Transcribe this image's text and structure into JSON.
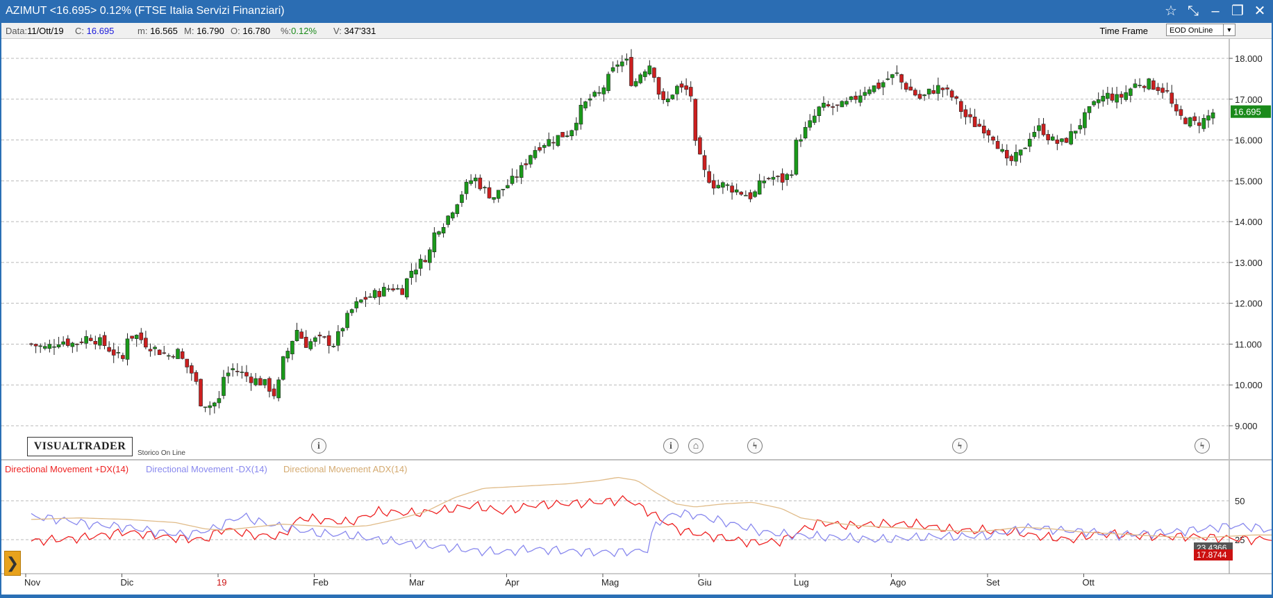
{
  "window": {
    "title": "AZIMUT <16.695> 0.12%  (FTSE Italia Servizi Finanziari)",
    "icons": [
      "star-icon",
      "pin-icon",
      "minimize-icon",
      "maximize-icon",
      "close-icon"
    ]
  },
  "info": {
    "data_label": "Data:",
    "data_value": "11/Ott/19",
    "c_label": "C:",
    "c_value": "16.695",
    "m_label": "m:",
    "m_value": "16.565",
    "M_label": "M:",
    "M_value": "16.790",
    "o_label": "O:",
    "o_value": "16.780",
    "pct_label": "%:",
    "pct_value": "0.12%",
    "v_label": "V:",
    "v_value": "347'331",
    "timeframe_label": "Time Frame",
    "timeframe_value": "EOD OnLine"
  },
  "branding": {
    "logo": "VISUALTRADER",
    "storico": "Storico On Line"
  },
  "colors": {
    "up": "#1a9a1a",
    "down": "#cc1f1f",
    "pdx": "#ee2222",
    "mdx": "#8888ee",
    "adx": "#e0bb88",
    "price_tag": "#1a8a1a",
    "red_tag": "#cc1111"
  },
  "chart_data": [
    {
      "type": "candlestick",
      "title": "",
      "last_price": "16.695",
      "x_labels": [
        {
          "label": "Nov",
          "month_index": 0
        },
        {
          "label": "Dic",
          "month_index": 1
        },
        {
          "label": "19",
          "month_index": 2
        },
        {
          "label": "Feb",
          "month_index": 3
        },
        {
          "label": "Mar",
          "month_index": 4
        },
        {
          "label": "Apr",
          "month_index": 5
        },
        {
          "label": "Mag",
          "month_index": 6
        },
        {
          "label": "Giu",
          "month_index": 7
        },
        {
          "label": "Lug",
          "month_index": 8
        },
        {
          "label": "Ago",
          "month_index": 9
        },
        {
          "label": "Set",
          "month_index": 10
        },
        {
          "label": "Ott",
          "month_index": 11
        }
      ],
      "y_ticks": [
        "9.000",
        "10.000",
        "11.000",
        "12.000",
        "13.000",
        "14.000",
        "15.000",
        "16.000",
        "17.000",
        "18.000"
      ],
      "ylim": [
        8.5,
        18.4
      ],
      "grid": true,
      "close_path": [
        [
          0,
          11.0
        ],
        [
          0.15,
          10.9
        ],
        [
          0.3,
          11.1
        ],
        [
          0.45,
          11.0
        ],
        [
          0.6,
          11.2
        ],
        [
          0.75,
          11.0
        ],
        [
          0.95,
          10.6
        ],
        [
          1.0,
          11.2
        ],
        [
          1.1,
          11.2
        ],
        [
          1.2,
          11.0
        ],
        [
          1.35,
          10.8
        ],
        [
          1.45,
          10.7
        ],
        [
          1.5,
          10.9
        ],
        [
          1.6,
          10.5
        ],
        [
          1.7,
          10.2
        ],
        [
          1.75,
          9.6
        ],
        [
          1.85,
          9.5
        ],
        [
          1.95,
          9.6
        ],
        [
          2.0,
          10.2
        ],
        [
          2.1,
          10.4
        ],
        [
          2.25,
          10.2
        ],
        [
          2.35,
          10.1
        ],
        [
          2.45,
          10.0
        ],
        [
          2.55,
          9.7
        ],
        [
          2.6,
          10.5
        ],
        [
          2.7,
          11.0
        ],
        [
          2.75,
          11.4
        ],
        [
          2.85,
          11.0
        ],
        [
          2.95,
          11.1
        ],
        [
          3.05,
          11.1
        ],
        [
          3.15,
          11.0
        ],
        [
          3.25,
          11.5
        ],
        [
          3.35,
          11.9
        ],
        [
          3.45,
          12.1
        ],
        [
          3.55,
          12.2
        ],
        [
          3.65,
          12.3
        ],
        [
          3.75,
          12.4
        ],
        [
          3.85,
          12.3
        ],
        [
          3.95,
          12.8
        ],
        [
          4.05,
          13.0
        ],
        [
          4.15,
          13.3
        ],
        [
          4.2,
          13.8
        ],
        [
          4.3,
          14.0
        ],
        [
          4.4,
          14.4
        ],
        [
          4.5,
          14.8
        ],
        [
          4.6,
          15.1
        ],
        [
          4.7,
          14.8
        ],
        [
          4.8,
          14.6
        ],
        [
          4.9,
          14.8
        ],
        [
          5.0,
          15.0
        ],
        [
          5.1,
          15.3
        ],
        [
          5.2,
          15.7
        ],
        [
          5.3,
          15.9
        ],
        [
          5.4,
          16.0
        ],
        [
          5.5,
          16.1
        ],
        [
          5.6,
          16.2
        ],
        [
          5.7,
          16.7
        ],
        [
          5.8,
          17.0
        ],
        [
          5.9,
          17.1
        ],
        [
          6.0,
          17.5
        ],
        [
          6.1,
          17.9
        ],
        [
          6.2,
          17.9
        ],
        [
          6.25,
          17.3
        ],
        [
          6.35,
          17.7
        ],
        [
          6.45,
          17.9
        ],
        [
          6.55,
          16.9
        ],
        [
          6.6,
          16.9
        ],
        [
          6.7,
          17.3
        ],
        [
          6.8,
          17.2
        ],
        [
          6.85,
          17.3
        ],
        [
          6.9,
          15.9
        ],
        [
          7.0,
          15.2
        ],
        [
          7.1,
          14.9
        ],
        [
          7.2,
          14.9
        ],
        [
          7.3,
          14.8
        ],
        [
          7.4,
          14.7
        ],
        [
          7.5,
          14.6
        ],
        [
          7.6,
          15.0
        ],
        [
          7.7,
          15.1
        ],
        [
          7.8,
          15.0
        ],
        [
          7.9,
          15.2
        ],
        [
          7.95,
          15.9
        ],
        [
          8.0,
          16.1
        ],
        [
          8.1,
          16.4
        ],
        [
          8.2,
          16.8
        ],
        [
          8.3,
          16.8
        ],
        [
          8.4,
          16.8
        ],
        [
          8.5,
          16.9
        ],
        [
          8.6,
          17.1
        ],
        [
          8.7,
          17.3
        ],
        [
          8.8,
          17.3
        ],
        [
          8.9,
          17.5
        ],
        [
          9.0,
          17.6
        ],
        [
          9.05,
          17.4
        ],
        [
          9.15,
          17.2
        ],
        [
          9.25,
          17.0
        ],
        [
          9.35,
          17.2
        ],
        [
          9.45,
          17.3
        ],
        [
          9.55,
          17.1
        ],
        [
          9.6,
          17.0
        ],
        [
          9.7,
          16.6
        ],
        [
          9.8,
          16.4
        ],
        [
          9.9,
          16.3
        ],
        [
          10.0,
          16.1
        ],
        [
          10.05,
          15.9
        ],
        [
          10.15,
          15.4
        ],
        [
          10.2,
          15.5
        ],
        [
          10.3,
          15.7
        ],
        [
          10.4,
          16.2
        ],
        [
          10.5,
          16.3
        ],
        [
          10.6,
          16.0
        ],
        [
          10.7,
          15.9
        ],
        [
          10.8,
          16.1
        ],
        [
          10.9,
          16.4
        ],
        [
          11.0,
          16.7
        ],
        [
          11.1,
          17.0
        ],
        [
          11.2,
          17.1
        ],
        [
          11.3,
          17.0
        ],
        [
          11.4,
          17.2
        ],
        [
          11.5,
          17.4
        ],
        [
          11.6,
          17.4
        ],
        [
          11.7,
          17.3
        ],
        [
          11.8,
          17.2
        ],
        [
          11.85,
          16.9
        ],
        [
          11.9,
          16.6
        ],
        [
          12.0,
          16.5
        ],
        [
          12.1,
          16.4
        ],
        [
          12.2,
          16.5
        ],
        [
          12.3,
          16.7
        ]
      ]
    },
    {
      "type": "line",
      "title": "",
      "series": [
        {
          "name": "Directional Movement +DX(14)",
          "color": "#ee2222",
          "path": [
            [
              0,
              24
            ],
            [
              0.5,
              26
            ],
            [
              1.0,
              30
            ],
            [
              1.5,
              26
            ],
            [
              1.8,
              25
            ],
            [
              2.0,
              32
            ],
            [
              2.3,
              28
            ],
            [
              2.6,
              27
            ],
            [
              2.8,
              39
            ],
            [
              3.0,
              38
            ],
            [
              3.3,
              36
            ],
            [
              3.6,
              43
            ],
            [
              4.0,
              42
            ],
            [
              4.3,
              44
            ],
            [
              4.6,
              47
            ],
            [
              4.9,
              43
            ],
            [
              5.2,
              47
            ],
            [
              5.5,
              48
            ],
            [
              5.9,
              49
            ],
            [
              6.2,
              51
            ],
            [
              6.5,
              40
            ],
            [
              6.7,
              32
            ],
            [
              6.9,
              29
            ],
            [
              7.2,
              26
            ],
            [
              7.5,
              23
            ],
            [
              7.8,
              24
            ],
            [
              8.0,
              31
            ],
            [
              8.2,
              36
            ],
            [
              8.5,
              34
            ],
            [
              8.8,
              35
            ],
            [
              9.2,
              35
            ],
            [
              9.6,
              31
            ],
            [
              9.9,
              31
            ],
            [
              10.2,
              30
            ],
            [
              10.5,
              27
            ],
            [
              10.8,
              25
            ],
            [
              11.1,
              29
            ],
            [
              11.4,
              28
            ],
            [
              11.7,
              27
            ],
            [
              11.9,
              27
            ],
            [
              12.1,
              27
            ],
            [
              12.4,
              26
            ],
            [
              12.7,
              25
            ],
            [
              12.9,
              26
            ]
          ]
        },
        {
          "name": "Directional Movement -DX(14)",
          "color": "#8888ee",
          "path": [
            [
              0,
              40
            ],
            [
              0.3,
              38
            ],
            [
              0.6,
              35
            ],
            [
              1.0,
              33
            ],
            [
              1.3,
              30
            ],
            [
              1.6,
              28
            ],
            [
              1.9,
              32
            ],
            [
              2.1,
              38
            ],
            [
              2.2,
              40
            ],
            [
              2.4,
              36
            ],
            [
              2.7,
              32
            ],
            [
              3.0,
              29
            ],
            [
              3.3,
              28
            ],
            [
              3.6,
              25
            ],
            [
              4.0,
              22
            ],
            [
              4.3,
              20
            ],
            [
              4.6,
              18
            ],
            [
              4.9,
              17
            ],
            [
              5.2,
              19
            ],
            [
              5.5,
              18
            ],
            [
              5.8,
              17
            ],
            [
              6.1,
              17
            ],
            [
              6.4,
              18
            ],
            [
              6.5,
              36
            ],
            [
              6.7,
              42
            ],
            [
              6.9,
              41
            ],
            [
              7.1,
              38
            ],
            [
              7.3,
              35
            ],
            [
              7.6,
              30
            ],
            [
              7.9,
              28
            ],
            [
              8.2,
              27
            ],
            [
              8.5,
              26
            ],
            [
              8.8,
              25
            ],
            [
              9.1,
              26
            ],
            [
              9.4,
              27
            ],
            [
              9.7,
              27
            ],
            [
              10.0,
              28
            ],
            [
              10.2,
              31
            ],
            [
              10.4,
              33
            ],
            [
              10.7,
              31
            ],
            [
              11.0,
              30
            ],
            [
              11.3,
              28
            ],
            [
              11.6,
              29
            ],
            [
              11.9,
              30
            ],
            [
              12.2,
              32
            ],
            [
              12.5,
              34
            ],
            [
              12.7,
              33
            ],
            [
              12.9,
              31
            ]
          ]
        },
        {
          "name": "Directional Movement ADX(14)",
          "color": "#e0bb88",
          "path": [
            [
              0,
              38
            ],
            [
              0.5,
              39
            ],
            [
              1.0,
              38
            ],
            [
              1.5,
              36
            ],
            [
              1.8,
              32
            ],
            [
              2.0,
              31
            ],
            [
              2.3,
              33
            ],
            [
              2.6,
              35
            ],
            [
              2.9,
              34
            ],
            [
              3.2,
              33
            ],
            [
              3.5,
              34
            ],
            [
              3.8,
              38
            ],
            [
              4.1,
              43
            ],
            [
              4.4,
              52
            ],
            [
              4.7,
              58
            ],
            [
              5.0,
              59
            ],
            [
              5.3,
              60
            ],
            [
              5.6,
              61
            ],
            [
              5.9,
              63
            ],
            [
              6.1,
              65
            ],
            [
              6.3,
              63
            ],
            [
              6.5,
              55
            ],
            [
              6.7,
              48
            ],
            [
              6.9,
              46
            ],
            [
              7.2,
              48
            ],
            [
              7.5,
              49
            ],
            [
              7.8,
              45
            ],
            [
              8.0,
              39
            ],
            [
              8.3,
              36
            ],
            [
              8.6,
              34
            ],
            [
              8.9,
              33
            ],
            [
              9.2,
              32
            ],
            [
              9.5,
              31
            ],
            [
              9.8,
              30
            ],
            [
              10.0,
              31
            ],
            [
              10.3,
              33
            ],
            [
              10.6,
              32
            ],
            [
              10.9,
              30
            ],
            [
              11.2,
              29
            ],
            [
              11.5,
              28
            ],
            [
              11.8,
              27
            ],
            [
              12.1,
              26
            ],
            [
              12.4,
              27
            ],
            [
              12.7,
              28
            ],
            [
              12.9,
              28
            ]
          ]
        }
      ],
      "y_ticks": [
        "50",
        "25"
      ],
      "ylim": [
        15,
        68
      ],
      "tags": [
        "23.4366",
        "17.8744"
      ]
    }
  ]
}
